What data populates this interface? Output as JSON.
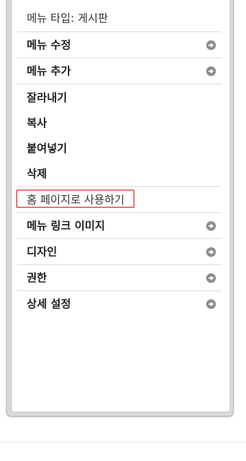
{
  "menu": {
    "type_label": "메뉴 타입: 게시판",
    "items": [
      {
        "label": "메뉴 수정",
        "has_arrow": true,
        "icon": "arrow-right-circle-icon"
      },
      {
        "label": "메뉴 추가",
        "has_arrow": true,
        "icon": "arrow-right-circle-icon"
      },
      {
        "label": "잘라내기",
        "has_arrow": false
      },
      {
        "label": "복사",
        "has_arrow": false
      },
      {
        "label": "붙여넣기",
        "has_arrow": false
      },
      {
        "label": "삭제",
        "has_arrow": false
      },
      {
        "label": "홈 페이지로 사용하기",
        "has_arrow": false,
        "highlighted": true
      },
      {
        "label": "메뉴 링크 이미지",
        "has_arrow": true,
        "icon": "arrow-right-circle-icon"
      },
      {
        "label": "디자인",
        "has_arrow": true,
        "icon": "arrow-right-circle-icon"
      },
      {
        "label": "권한",
        "has_arrow": true,
        "icon": "arrow-right-circle-icon"
      },
      {
        "label": "상세 설정",
        "has_arrow": true,
        "icon": "arrow-right-circle-icon"
      }
    ]
  },
  "colors": {
    "highlight_border": "#d40000",
    "arrow_icon": "#8c8c8c",
    "divider": "#dadada"
  }
}
